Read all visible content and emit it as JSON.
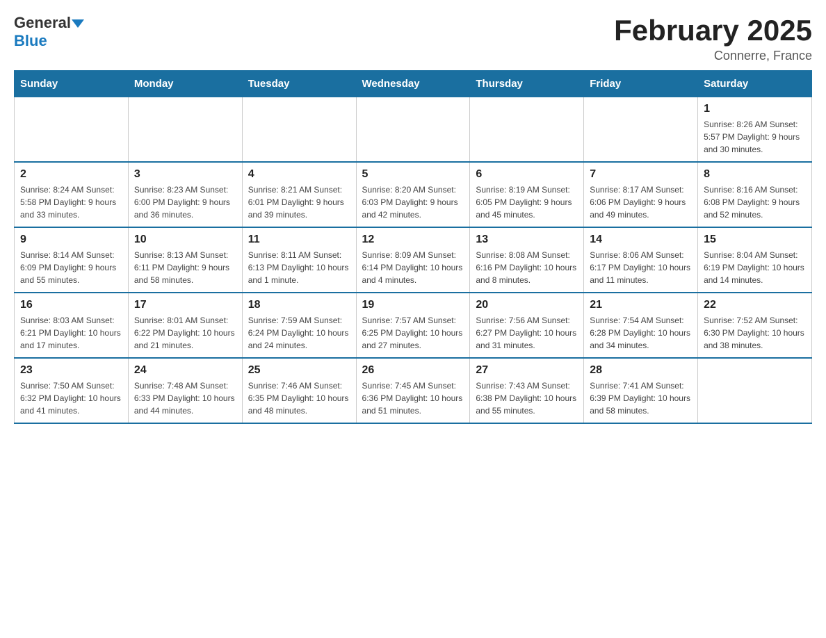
{
  "logo": {
    "general": "General",
    "arrow": "▼",
    "blue": "Blue"
  },
  "title": "February 2025",
  "location": "Connerre, France",
  "days_of_week": [
    "Sunday",
    "Monday",
    "Tuesday",
    "Wednesday",
    "Thursday",
    "Friday",
    "Saturday"
  ],
  "weeks": [
    [
      {
        "day": "",
        "info": ""
      },
      {
        "day": "",
        "info": ""
      },
      {
        "day": "",
        "info": ""
      },
      {
        "day": "",
        "info": ""
      },
      {
        "day": "",
        "info": ""
      },
      {
        "day": "",
        "info": ""
      },
      {
        "day": "1",
        "info": "Sunrise: 8:26 AM\nSunset: 5:57 PM\nDaylight: 9 hours and 30 minutes."
      }
    ],
    [
      {
        "day": "2",
        "info": "Sunrise: 8:24 AM\nSunset: 5:58 PM\nDaylight: 9 hours and 33 minutes."
      },
      {
        "day": "3",
        "info": "Sunrise: 8:23 AM\nSunset: 6:00 PM\nDaylight: 9 hours and 36 minutes."
      },
      {
        "day": "4",
        "info": "Sunrise: 8:21 AM\nSunset: 6:01 PM\nDaylight: 9 hours and 39 minutes."
      },
      {
        "day": "5",
        "info": "Sunrise: 8:20 AM\nSunset: 6:03 PM\nDaylight: 9 hours and 42 minutes."
      },
      {
        "day": "6",
        "info": "Sunrise: 8:19 AM\nSunset: 6:05 PM\nDaylight: 9 hours and 45 minutes."
      },
      {
        "day": "7",
        "info": "Sunrise: 8:17 AM\nSunset: 6:06 PM\nDaylight: 9 hours and 49 minutes."
      },
      {
        "day": "8",
        "info": "Sunrise: 8:16 AM\nSunset: 6:08 PM\nDaylight: 9 hours and 52 minutes."
      }
    ],
    [
      {
        "day": "9",
        "info": "Sunrise: 8:14 AM\nSunset: 6:09 PM\nDaylight: 9 hours and 55 minutes."
      },
      {
        "day": "10",
        "info": "Sunrise: 8:13 AM\nSunset: 6:11 PM\nDaylight: 9 hours and 58 minutes."
      },
      {
        "day": "11",
        "info": "Sunrise: 8:11 AM\nSunset: 6:13 PM\nDaylight: 10 hours and 1 minute."
      },
      {
        "day": "12",
        "info": "Sunrise: 8:09 AM\nSunset: 6:14 PM\nDaylight: 10 hours and 4 minutes."
      },
      {
        "day": "13",
        "info": "Sunrise: 8:08 AM\nSunset: 6:16 PM\nDaylight: 10 hours and 8 minutes."
      },
      {
        "day": "14",
        "info": "Sunrise: 8:06 AM\nSunset: 6:17 PM\nDaylight: 10 hours and 11 minutes."
      },
      {
        "day": "15",
        "info": "Sunrise: 8:04 AM\nSunset: 6:19 PM\nDaylight: 10 hours and 14 minutes."
      }
    ],
    [
      {
        "day": "16",
        "info": "Sunrise: 8:03 AM\nSunset: 6:21 PM\nDaylight: 10 hours and 17 minutes."
      },
      {
        "day": "17",
        "info": "Sunrise: 8:01 AM\nSunset: 6:22 PM\nDaylight: 10 hours and 21 minutes."
      },
      {
        "day": "18",
        "info": "Sunrise: 7:59 AM\nSunset: 6:24 PM\nDaylight: 10 hours and 24 minutes."
      },
      {
        "day": "19",
        "info": "Sunrise: 7:57 AM\nSunset: 6:25 PM\nDaylight: 10 hours and 27 minutes."
      },
      {
        "day": "20",
        "info": "Sunrise: 7:56 AM\nSunset: 6:27 PM\nDaylight: 10 hours and 31 minutes."
      },
      {
        "day": "21",
        "info": "Sunrise: 7:54 AM\nSunset: 6:28 PM\nDaylight: 10 hours and 34 minutes."
      },
      {
        "day": "22",
        "info": "Sunrise: 7:52 AM\nSunset: 6:30 PM\nDaylight: 10 hours and 38 minutes."
      }
    ],
    [
      {
        "day": "23",
        "info": "Sunrise: 7:50 AM\nSunset: 6:32 PM\nDaylight: 10 hours and 41 minutes."
      },
      {
        "day": "24",
        "info": "Sunrise: 7:48 AM\nSunset: 6:33 PM\nDaylight: 10 hours and 44 minutes."
      },
      {
        "day": "25",
        "info": "Sunrise: 7:46 AM\nSunset: 6:35 PM\nDaylight: 10 hours and 48 minutes."
      },
      {
        "day": "26",
        "info": "Sunrise: 7:45 AM\nSunset: 6:36 PM\nDaylight: 10 hours and 51 minutes."
      },
      {
        "day": "27",
        "info": "Sunrise: 7:43 AM\nSunset: 6:38 PM\nDaylight: 10 hours and 55 minutes."
      },
      {
        "day": "28",
        "info": "Sunrise: 7:41 AM\nSunset: 6:39 PM\nDaylight: 10 hours and 58 minutes."
      },
      {
        "day": "",
        "info": ""
      }
    ]
  ]
}
